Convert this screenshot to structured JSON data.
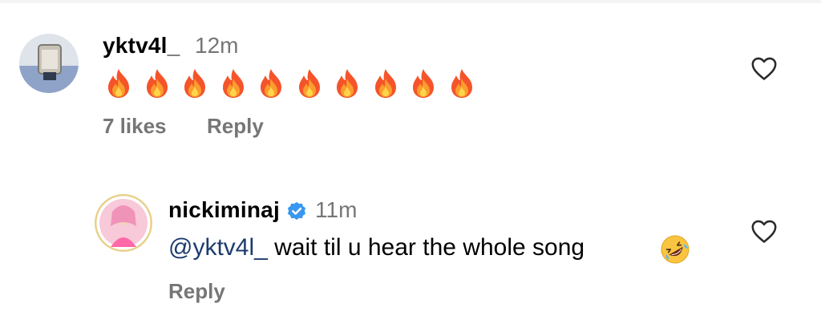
{
  "comments": [
    {
      "username": "yktv4l_",
      "time": "12m",
      "emoji_count": 10,
      "emoji_icon": "fire-emoji",
      "likes": "7 likes",
      "reply_label": "Reply"
    }
  ],
  "reply": {
    "username": "nickiminaj",
    "verified": true,
    "time": "11m",
    "mention": "@yktv4l_",
    "text": " wait til u hear the whole song",
    "emoji_icon": "rolling-on-floor-laughing-emoji",
    "reply_label": "Reply"
  },
  "colors": {
    "mention": "#1c3b6e",
    "meta": "#767676",
    "verified": "#3897f0",
    "avatar_ring": "#e8d08a"
  }
}
